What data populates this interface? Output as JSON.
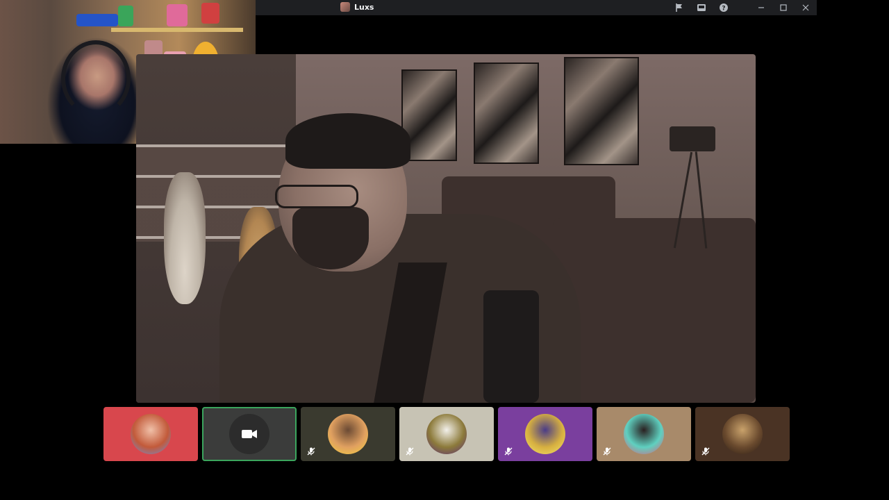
{
  "window": {
    "title": "Luxs",
    "controls": [
      "flag-icon",
      "inbox-icon",
      "help-icon",
      "minimize-icon",
      "maximize-icon",
      "close-icon"
    ]
  },
  "participants": [
    {
      "id": "p1",
      "bg": "#d8474d",
      "avatar_colors": [
        "#f0c0a8",
        "#c25a3a",
        "#6f8cd9"
      ],
      "muted": false,
      "active": false
    },
    {
      "id": "p2",
      "bg": "#3b3c3b",
      "avatar_colors": [
        "#2c2c2c",
        "#2c2c2c",
        "#2c2c2c"
      ],
      "muted": false,
      "active": true,
      "camera_tile": true
    },
    {
      "id": "p3",
      "bg": "#3a3a2f",
      "avatar_colors": [
        "#6b4a34",
        "#e0a060",
        "#f3d040"
      ],
      "muted": true,
      "active": false
    },
    {
      "id": "p4",
      "bg": "#c7c3b4",
      "avatar_colors": [
        "#f2f0ea",
        "#8c7a3a",
        "#5c2e7a"
      ],
      "muted": true,
      "active": false
    },
    {
      "id": "p5",
      "bg": "#7a3f9e",
      "avatar_colors": [
        "#4a3c88",
        "#d7b040",
        "#f4e36a"
      ],
      "muted": true,
      "active": false
    },
    {
      "id": "p6",
      "bg": "#a88a6a",
      "avatar_colors": [
        "#2a2020",
        "#5fd0c0",
        "#e05a7a"
      ],
      "muted": true,
      "active": false
    },
    {
      "id": "p7",
      "bg": "#4a3324",
      "avatar_colors": [
        "#c9a26b",
        "#6a4a2e",
        "#2a1c14"
      ],
      "muted": true,
      "active": false
    }
  ],
  "colors": {
    "active_outline": "#3ba55d",
    "titlebar": "#1e1f22",
    "icon_muted": "#ffffff"
  }
}
